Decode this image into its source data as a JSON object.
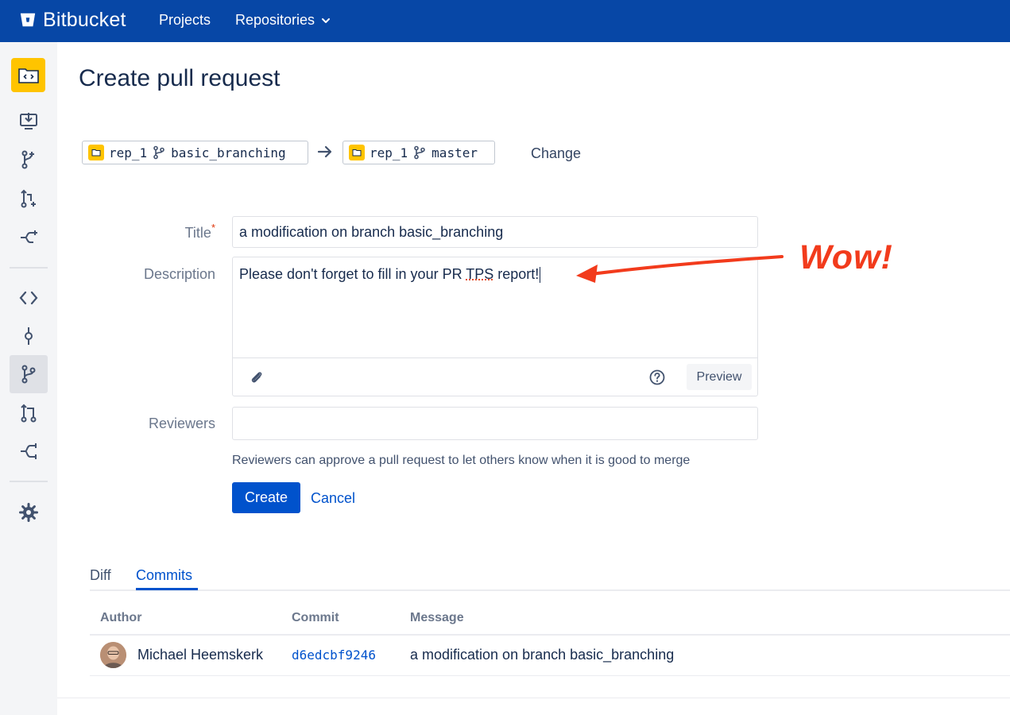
{
  "topbar": {
    "brand": "Bitbucket",
    "nav": {
      "projects": "Projects",
      "repositories": "Repositories"
    },
    "background_color": "#0747a6"
  },
  "sidebar": {
    "repo_avatar_icon": "code-folder-icon",
    "items": [
      {
        "icon": "clone-download-icon",
        "active": false
      },
      {
        "icon": "create-branch-icon",
        "active": false
      },
      {
        "icon": "create-pull-request-icon",
        "active": false
      },
      {
        "icon": "fork-icon",
        "active": false
      },
      {
        "icon": "source-code-icon",
        "active": false
      },
      {
        "icon": "commits-icon",
        "active": false
      },
      {
        "icon": "branches-icon",
        "active": true
      },
      {
        "icon": "pull-requests-icon",
        "active": false
      },
      {
        "icon": "forks-icon",
        "active": false
      },
      {
        "icon": "settings-gear-icon",
        "active": false
      }
    ]
  },
  "page": {
    "title": "Create pull request"
  },
  "branches": {
    "source": {
      "repo": "rep_1",
      "branch": "basic_branching"
    },
    "target": {
      "repo": "rep_1",
      "branch": "master"
    },
    "change_label": "Change"
  },
  "form": {
    "title_label": "Title",
    "required_mark": "*",
    "title_value": "a modification on branch basic_branching",
    "description_label": "Description",
    "description_before": "Please don't forget to fill in your PR ",
    "description_misspelled": "TPS",
    "description_after": " report!",
    "preview_label": "Preview",
    "reviewers_label": "Reviewers",
    "reviewers_value": "",
    "reviewers_hint": "Reviewers can approve a pull request to let others know when it is good to merge",
    "create_label": "Create",
    "cancel_label": "Cancel"
  },
  "annotation": {
    "text": "Wow!",
    "color": "#f23b1c"
  },
  "tabs": [
    {
      "label": "Diff",
      "active": false
    },
    {
      "label": "Commits",
      "active": true
    }
  ],
  "commits": {
    "columns": {
      "author": "Author",
      "commit": "Commit",
      "message": "Message"
    },
    "rows": [
      {
        "author": "Michael Heemskerk",
        "hash": "d6edcbf9246",
        "message": "a modification on branch basic_branching"
      }
    ]
  },
  "colors": {
    "primary": "#0052cc",
    "folder": "#ffc400"
  }
}
